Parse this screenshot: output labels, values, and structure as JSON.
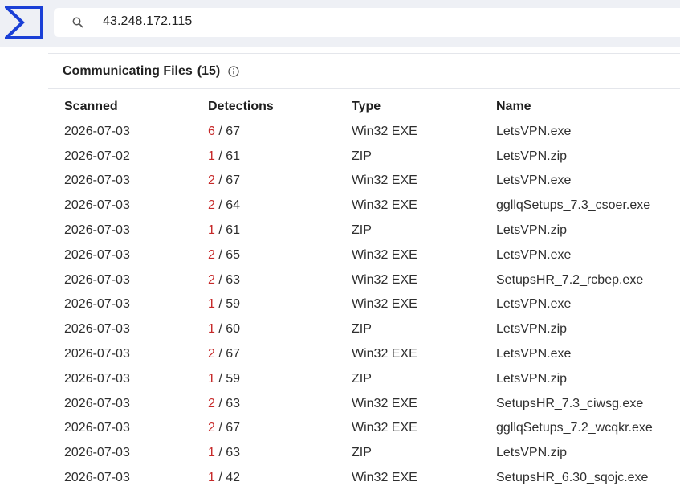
{
  "search": {
    "value": "43.248.172.115"
  },
  "section": {
    "title": "Communicating Files",
    "count": "(15)"
  },
  "table": {
    "headers": [
      "Scanned",
      "Detections",
      "Type",
      "Name"
    ],
    "rows": [
      {
        "scanned": "2026-07-03",
        "positives": "6",
        "total": "/ 67",
        "type": "Win32 EXE",
        "name": "LetsVPN.exe"
      },
      {
        "scanned": "2026-07-02",
        "positives": "1",
        "total": "/ 61",
        "type": "ZIP",
        "name": "LetsVPN.zip"
      },
      {
        "scanned": "2026-07-03",
        "positives": "2",
        "total": "/ 67",
        "type": "Win32 EXE",
        "name": "LetsVPN.exe"
      },
      {
        "scanned": "2026-07-03",
        "positives": "2",
        "total": "/ 64",
        "type": "Win32 EXE",
        "name": "ggllqSetups_7.3_csoer.exe"
      },
      {
        "scanned": "2026-07-03",
        "positives": "1",
        "total": "/ 61",
        "type": "ZIP",
        "name": "LetsVPN.zip"
      },
      {
        "scanned": "2026-07-03",
        "positives": "2",
        "total": "/ 65",
        "type": "Win32 EXE",
        "name": "LetsVPN.exe"
      },
      {
        "scanned": "2026-07-03",
        "positives": "2",
        "total": "/ 63",
        "type": "Win32 EXE",
        "name": "SetupsHR_7.2_rcbep.exe"
      },
      {
        "scanned": "2026-07-03",
        "positives": "1",
        "total": "/ 59",
        "type": "Win32 EXE",
        "name": "LetsVPN.exe"
      },
      {
        "scanned": "2026-07-03",
        "positives": "1",
        "total": "/ 60",
        "type": "ZIP",
        "name": "LetsVPN.zip"
      },
      {
        "scanned": "2026-07-03",
        "positives": "2",
        "total": "/ 67",
        "type": "Win32 EXE",
        "name": "LetsVPN.exe"
      },
      {
        "scanned": "2026-07-03",
        "positives": "1",
        "total": "/ 59",
        "type": "ZIP",
        "name": "LetsVPN.zip"
      },
      {
        "scanned": "2026-07-03",
        "positives": "2",
        "total": "/ 63",
        "type": "Win32 EXE",
        "name": "SetupsHR_7.3_ciwsg.exe"
      },
      {
        "scanned": "2026-07-03",
        "positives": "2",
        "total": "/ 67",
        "type": "Win32 EXE",
        "name": "ggllqSetups_7.2_wcqkr.exe"
      },
      {
        "scanned": "2026-07-03",
        "positives": "1",
        "total": "/ 63",
        "type": "ZIP",
        "name": "LetsVPN.zip"
      },
      {
        "scanned": "2026-07-03",
        "positives": "1",
        "total": "/ 42",
        "type": "Win32 EXE",
        "name": "SetupsHR_6.30_sqojc.exe"
      }
    ]
  },
  "colors": {
    "brand": "#1a3fd6",
    "detection": "#c62828",
    "topbar": "#eef0f5"
  },
  "icons": {
    "logo": "virustotal-logo-icon",
    "search": "search-icon",
    "info": "info-icon"
  }
}
